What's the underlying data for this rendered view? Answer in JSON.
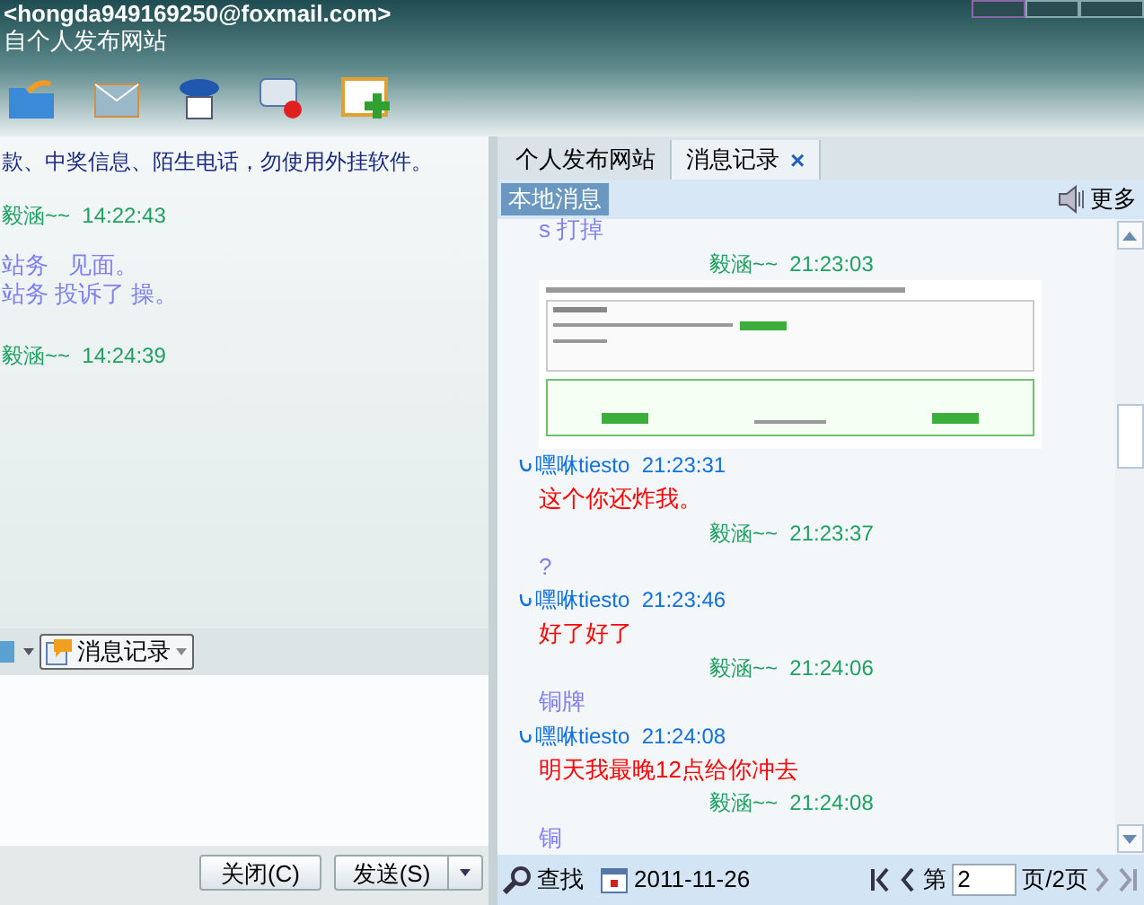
{
  "window": {
    "title": "<hongda949169250@foxmail.com>",
    "subtitle": "自个人发布网站"
  },
  "left_chat": {
    "notice": "款、中奖信息、陌生电话，勿使用外挂软件。",
    "messages": [
      {
        "kind": "me",
        "sender": "毅涵~~",
        "time": "14:22:43"
      },
      {
        "kind": "text",
        "text": "站务   见面。"
      },
      {
        "kind": "text",
        "text": "站务 投诉了 操。"
      },
      {
        "kind": "me",
        "sender": "毅涵~~",
        "time": "14:24:39"
      }
    ]
  },
  "input_toolbar": {
    "history_button": "消息记录"
  },
  "buttons": {
    "close": "关闭(C)",
    "send": "发送(S)"
  },
  "tabs": [
    {
      "label": "个人发布网站",
      "selected": false
    },
    {
      "label": "消息记录",
      "selected": true,
      "close": "×"
    }
  ],
  "history": {
    "badge": "本地消息",
    "more": "更多",
    "messages": [
      {
        "kind": "text",
        "text": "s 打掉"
      },
      {
        "kind": "me",
        "sender": "毅涵~~",
        "time": "21:23:03"
      },
      {
        "kind": "image"
      },
      {
        "kind": "them",
        "sender": "嘿咻tiesto",
        "time": "21:23:31"
      },
      {
        "kind": "reply",
        "text": "这个你还炸我。"
      },
      {
        "kind": "me",
        "sender": "毅涵~~",
        "time": "21:23:37"
      },
      {
        "kind": "text",
        "text": "?"
      },
      {
        "kind": "them",
        "sender": "嘿咻tiesto",
        "time": "21:23:46"
      },
      {
        "kind": "reply",
        "text": "好了好了"
      },
      {
        "kind": "me",
        "sender": "毅涵~~",
        "time": "21:24:06"
      },
      {
        "kind": "text",
        "text": "铜牌"
      },
      {
        "kind": "them",
        "sender": "嘿咻tiesto",
        "time": "21:24:08"
      },
      {
        "kind": "reply",
        "text": "明天我最晚12点给你冲去"
      },
      {
        "kind": "me",
        "sender": "毅涵~~",
        "time": "21:24:08"
      },
      {
        "kind": "text",
        "text": "铜"
      }
    ],
    "footer": {
      "search": "查找",
      "date": "2011-11-26",
      "page_prefix": "第",
      "page": "2",
      "page_suffix": "页/2页"
    }
  }
}
